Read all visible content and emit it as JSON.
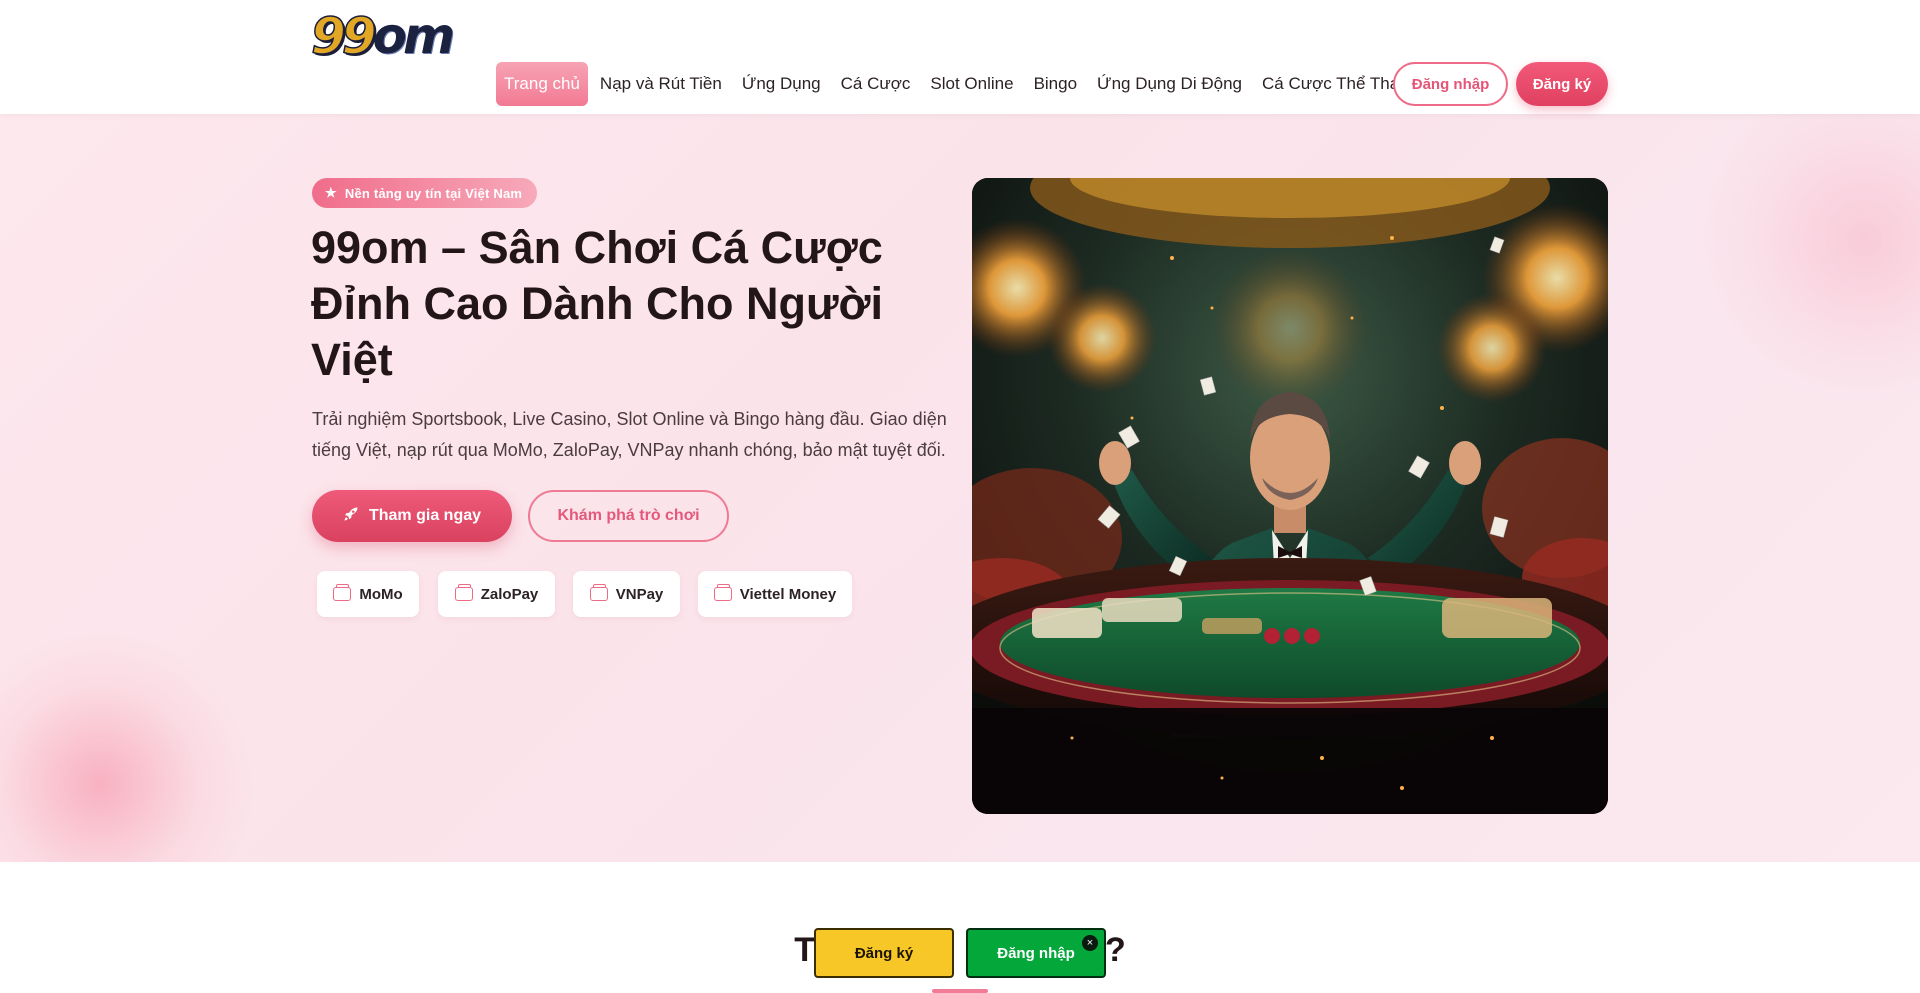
{
  "brand": {
    "logo_part1": "99",
    "logo_part2": "om"
  },
  "nav": {
    "items": [
      {
        "label": "Trang chủ",
        "active": true
      },
      {
        "label": "Nạp và Rút Tiền"
      },
      {
        "label": "Ứng Dụng"
      },
      {
        "label": "Cá Cược"
      },
      {
        "label": "Slot Online"
      },
      {
        "label": "Bingo"
      },
      {
        "label": "Ứng Dụng Di Động"
      },
      {
        "label": "Cá Cược Thể Thao"
      }
    ],
    "login_label": "Đăng nhập",
    "register_label": "Đăng ký"
  },
  "hero": {
    "badge": "Nền tảng uy tín tại Việt Nam",
    "badge_icon": "star-icon",
    "title": "99om – Sân Chơi Cá Cược Đỉnh Cao Dành Cho Người Việt",
    "description": "Trải nghiệm Sportsbook, Live Casino, Slot Online và Bingo hàng đầu. Giao diện tiếng Việt, nạp rút qua MoMo, ZaloPay, VNPay nhanh chóng, bảo mật tuyệt đối.",
    "cta_primary": "Tham gia ngay",
    "cta_primary_icon": "rocket-icon",
    "cta_secondary": "Khám phá trò chơi",
    "payments": [
      "MoMo",
      "ZaloPay",
      "VNPay",
      "Viettel Money"
    ],
    "payment_icon": "wallet-icon",
    "image_alt": "Casino dealer at a poker table"
  },
  "section2": {
    "title_left": "T",
    "title_right": "?"
  },
  "floating": {
    "register_label": "Đăng ký",
    "login_label": "Đăng nhập",
    "close_symbol": "×"
  },
  "colors": {
    "accent": "#ef5a7a",
    "accent_light": "#f7a9ba",
    "hero_bg": "#fbe3ea",
    "float_yellow": "#f7c627",
    "float_green": "#04a83a"
  }
}
